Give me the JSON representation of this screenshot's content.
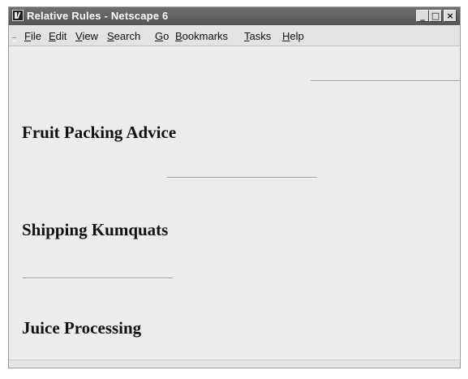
{
  "window": {
    "title": "Relative Rules - Netscape 6",
    "controls": {
      "minimize": "_",
      "maximize": "□",
      "close": "×"
    }
  },
  "menubar": {
    "items": [
      {
        "pre": "",
        "ul": "F",
        "post": "ile"
      },
      {
        "pre": "",
        "ul": "E",
        "post": "dit"
      },
      {
        "pre": "",
        "ul": "V",
        "post": "iew"
      },
      {
        "pre": "",
        "ul": "S",
        "post": "earch"
      },
      {
        "pre": "",
        "ul": "G",
        "post": "o"
      },
      {
        "pre": "",
        "ul": "B",
        "post": "ookmarks"
      },
      {
        "pre": "",
        "ul": "T",
        "post": "asks"
      },
      {
        "pre": "",
        "ul": "H",
        "post": "elp"
      }
    ]
  },
  "content": {
    "headings": [
      "Fruit Packing Advice",
      "Shipping Kumquats",
      "Juice Processing"
    ],
    "rules": [
      {
        "align": "right",
        "width_percent": 33
      },
      {
        "align": "center",
        "width_percent": 33
      },
      {
        "align": "left",
        "width_percent": 33
      }
    ]
  }
}
